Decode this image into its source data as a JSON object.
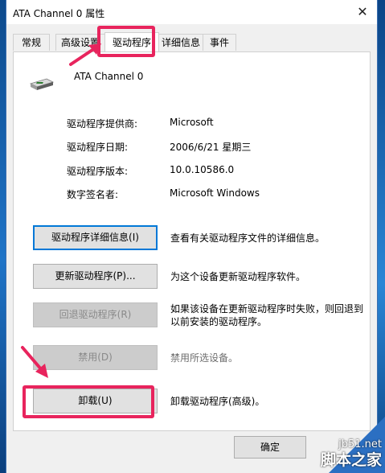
{
  "window": {
    "title": "ATA Channel 0 属性",
    "close_glyph": "✕"
  },
  "tabs": [
    {
      "label": "常规"
    },
    {
      "label": "高级设置"
    },
    {
      "label": "驱动程序",
      "active": true
    },
    {
      "label": "详细信息"
    },
    {
      "label": "事件"
    }
  ],
  "device": {
    "name": "ATA Channel 0",
    "icon": "ide-controller-icon"
  },
  "info": [
    {
      "label": "驱动程序提供商:",
      "value": "Microsoft"
    },
    {
      "label": "驱动程序日期:",
      "value": "2006/6/21 星期三"
    },
    {
      "label": "驱动程序版本:",
      "value": "10.0.10586.0"
    },
    {
      "label": "数字签名者:",
      "value": "Microsoft Windows"
    }
  ],
  "actions": [
    {
      "button": "驱动程序详细信息(I)",
      "description": "查看有关驱动程序文件的详细信息。",
      "enabled": true
    },
    {
      "button": "更新驱动程序(P)...",
      "description": "为这个设备更新驱动程序软件。",
      "enabled": true
    },
    {
      "button": "回退驱动程序(R)",
      "description": "如果该设备在更新驱动程序时失败，则回退到以前安装的驱动程序。",
      "enabled": false
    },
    {
      "button": "禁用(D)",
      "description": "禁用所选设备。",
      "enabled": false
    },
    {
      "button": "卸载(U)",
      "description": "卸载驱动程序(高级)。",
      "enabled": true
    }
  ],
  "footer": {
    "ok": "确定"
  },
  "watermark": {
    "domain": "jb51.net",
    "name": "脚本之家"
  },
  "colors": {
    "highlight": "#e8245d",
    "focus": "#0078d7",
    "desktop": "#1a5fa8"
  }
}
